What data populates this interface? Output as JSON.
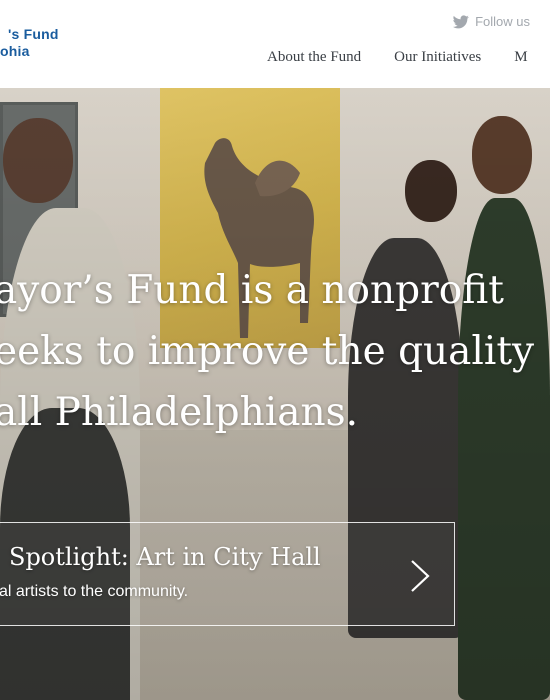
{
  "header": {
    "logo_line1": "'s Fund",
    "logo_line2": "ohia",
    "follow_label": "Follow us",
    "nav": [
      {
        "label": "About the Fund"
      },
      {
        "label": "Our Initiatives"
      },
      {
        "label": "M"
      }
    ]
  },
  "hero": {
    "headline_lines": [
      "ayor’s Fund is a nonprofit",
      "eeks to improve the quality",
      "all Philadelphians."
    ],
    "spotlight_title": "Spotlight: Art in City Hall",
    "spotlight_subtitle": "al artists to the community."
  },
  "colors": {
    "brand_blue": "#1a5c9e",
    "nav_text": "#3a3f45",
    "follow_gray": "#a3a8ae"
  },
  "icons": [
    "twitter-bird-icon",
    "chevron-right-icon"
  ]
}
